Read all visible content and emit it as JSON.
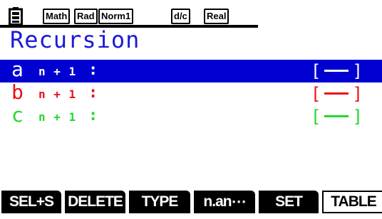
{
  "status_bar": {
    "battery_icon": "battery-icon",
    "indicators": [
      "Math",
      "Rad",
      "Norm1",
      "d/c",
      "Real"
    ]
  },
  "screen": {
    "title": "Recursion"
  },
  "rows": [
    {
      "name": "a",
      "sub": "n + 1",
      "colon": ":",
      "style": "[—]",
      "color": "#ffffff",
      "line_color": "#ffffff",
      "selected": true
    },
    {
      "name": "b",
      "sub": "n + 1",
      "colon": ":",
      "style": "[—]",
      "color": "#e8101c",
      "line_color": "#e8101c",
      "selected": false
    },
    {
      "name": "c",
      "sub": "n + 1",
      "colon": ":",
      "style": "[—]",
      "color": "#22d82a",
      "line_color": "#22d82a",
      "selected": false
    }
  ],
  "colors": {
    "title": "#1a1ad6",
    "selected_row_bg": "#0000d0"
  },
  "function_keys": [
    "SEL+S",
    "DELETE",
    "TYPE",
    "n.an⋯",
    "SET",
    "TABLE"
  ]
}
